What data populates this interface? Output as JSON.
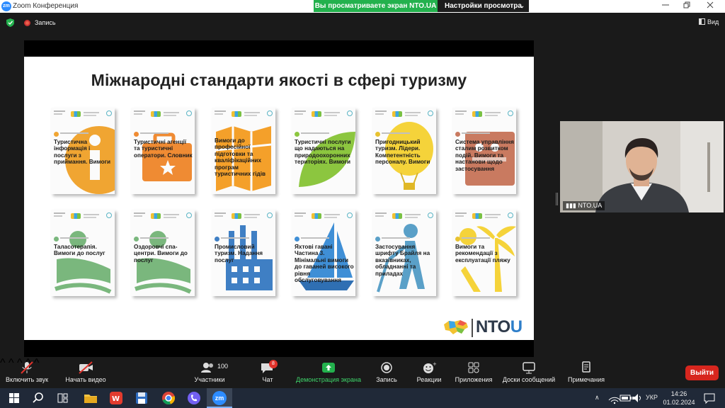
{
  "window": {
    "title": "Zoom Конференция",
    "logo_text": "zm",
    "share_banner": "Вы просматриваете экран NTO.UA",
    "view_options": "Настройки просмотра"
  },
  "topbar": {
    "record_label": "Запись",
    "view_label": "Вид"
  },
  "slide": {
    "title": "Міжнародні стандарти якості в сфері туризму",
    "logo_text": "NTO",
    "logo_accent": "U",
    "cards": [
      {
        "text": "Туристична інформація і послуги з приймання. Вимоги",
        "icon": "info-icon",
        "color": "#f0a532"
      },
      {
        "text": "Туристичні агенції та туристичні оператори. Словник",
        "icon": "suitcase-icon",
        "color": "#ef8b33"
      },
      {
        "text": "Вимоги до професійної підготовки та кваліфікаційних програм туристичних гідів",
        "icon": "map-icon",
        "color": "#f4a02a"
      },
      {
        "text": "Туристичні послуги що надаються на природоохоронних територіях. Вимоги",
        "icon": "leaf-icon",
        "color": "#8cc63f"
      },
      {
        "text": "Пригодницький туризм. Лідери. Компетентність персоналу. Вимоги",
        "icon": "balloon-icon",
        "color": "#f5d33a"
      },
      {
        "text": "Система управління сталим розвитком подій. Вимоги та настанови щодо застосування",
        "icon": "event-icon",
        "color": "#c97a60"
      },
      {
        "text": "Таласотерапія. Вимоги до послуг",
        "icon": "spa-icon",
        "color": "#7ab77d"
      },
      {
        "text": "Оздоровчі спа-центри. Вимоги до послуг",
        "icon": "spa-icon",
        "color": "#7ab77d"
      },
      {
        "text": "Промисловий туризм. Надання послуг",
        "icon": "factory-icon",
        "color": "#3f7fc4"
      },
      {
        "text": "Яхтові гавані Частина 3. Мінімальні вимоги до гаваней високого рівня обслуговування",
        "icon": "sailboat-icon",
        "color": "#3f8fd6"
      },
      {
        "text": "Застосування шрифту Брайля на вказівниках, обладнанні та приладах",
        "icon": "walking-icon",
        "color": "#5aa0c8"
      },
      {
        "text": "Вимоги та рекомендації з експлуатації пляжу",
        "icon": "palm-icon",
        "color": "#f5d33a"
      }
    ]
  },
  "video": {
    "participant_name": "NTO.UA"
  },
  "toolbar": {
    "mute": "Включить звук",
    "video": "Начать видео",
    "participants": "Участники",
    "participants_count": "100",
    "chat": "Чат",
    "chat_badge": "8",
    "share": "Демонстрация экрана",
    "record": "Запись",
    "reactions": "Реакции",
    "apps": "Приложения",
    "whiteboard": "Доски сообщений",
    "notes": "Примечания",
    "exit": "Выйти"
  },
  "taskbar": {
    "language": "УКР",
    "time": "14:26",
    "date": "01.02.2024"
  }
}
